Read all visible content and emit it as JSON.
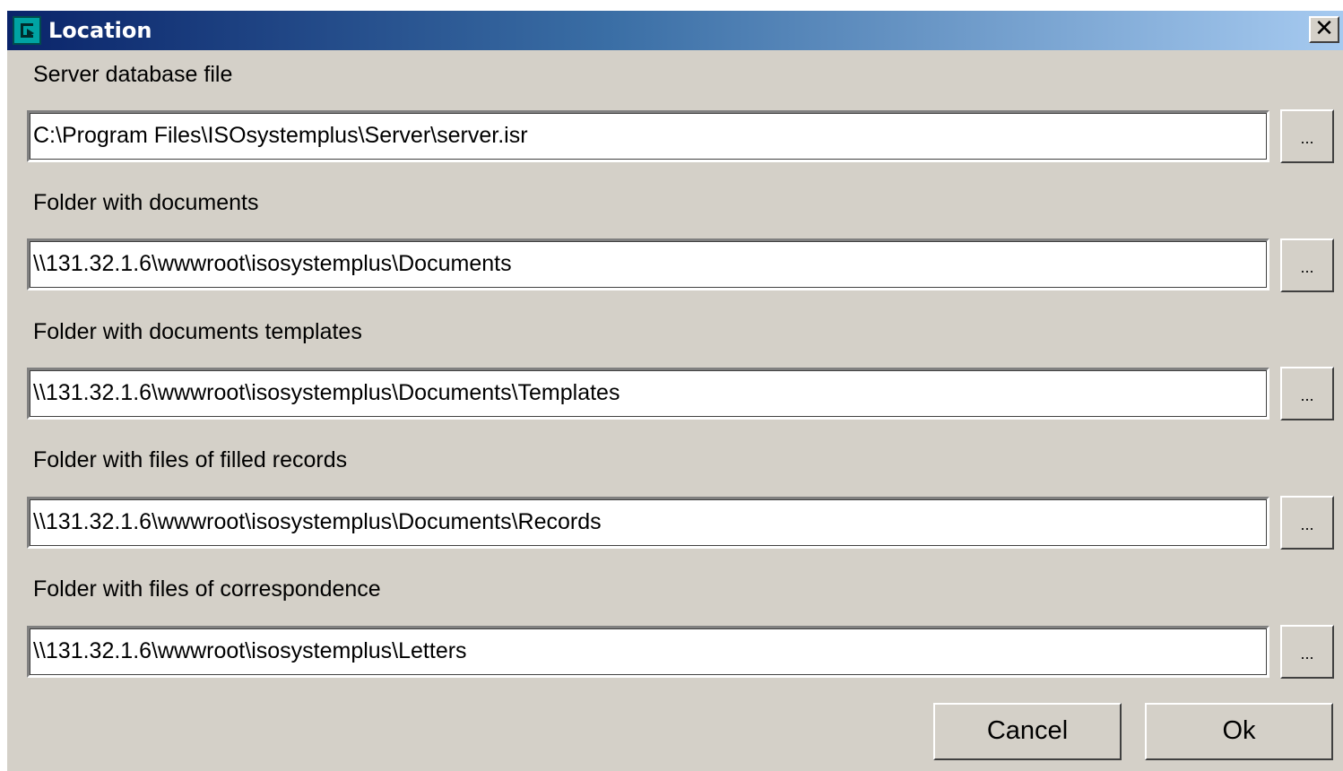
{
  "window": {
    "title": "Location",
    "close_label": "✕"
  },
  "fields": [
    {
      "label": "Server database  file",
      "value": "C:\\Program Files\\ISOsystemplus\\Server\\server.isr",
      "browse_label": "..."
    },
    {
      "label": "Folder with documents",
      "value": "\\\\131.32.1.6\\wwwroot\\isosystemplus\\Documents",
      "browse_label": "..."
    },
    {
      "label": "Folder with documents templates",
      "value": "\\\\131.32.1.6\\wwwroot\\isosystemplus\\Documents\\Templates",
      "browse_label": "..."
    },
    {
      "label": "Folder with files of filled records",
      "value": "\\\\131.32.1.6\\wwwroot\\isosystemplus\\Documents\\Records",
      "browse_label": "..."
    },
    {
      "label": "Folder with files of correspondence",
      "value": "\\\\131.32.1.6\\wwwroot\\isosystemplus\\Letters",
      "browse_label": "..."
    }
  ],
  "buttons": {
    "cancel_label": "Cancel",
    "ok_label": "Ok"
  },
  "colors": {
    "titlebar_start": "#0a246a",
    "titlebar_end": "#a6caf0",
    "face": "#d4d0c8"
  }
}
